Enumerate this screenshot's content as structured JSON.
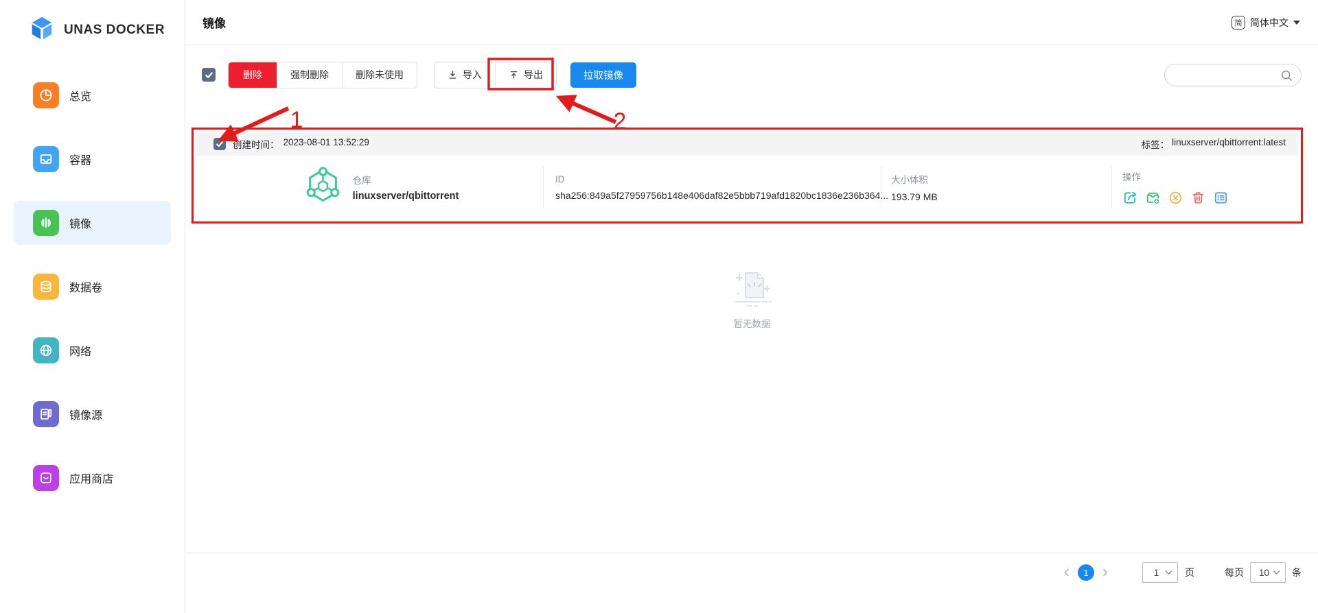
{
  "app": {
    "brand": "UNAS DOCKER"
  },
  "sidebar": {
    "items": [
      {
        "label": "总览",
        "icon": "overview-icon",
        "color": "#fa7e23",
        "active": false
      },
      {
        "label": "容器",
        "icon": "container-icon",
        "color": "#41a4f5",
        "active": false
      },
      {
        "label": "镜像",
        "icon": "image-icon",
        "color": "#47c353",
        "active": true
      },
      {
        "label": "数据卷",
        "icon": "volume-icon",
        "color": "#f6b73c",
        "active": false
      },
      {
        "label": "网络",
        "icon": "network-icon",
        "color": "#41b5c2",
        "active": false
      },
      {
        "label": "镜像源",
        "icon": "registry-icon",
        "color": "#6f6bd0",
        "active": false
      },
      {
        "label": "应用商店",
        "icon": "appstore-icon",
        "color": "#bb41e5",
        "active": false
      }
    ]
  },
  "header": {
    "title": "镜像",
    "language_badge": "简",
    "language": "简体中文"
  },
  "toolbar": {
    "delete": "删除",
    "force_delete": "强制删除",
    "delete_unused": "删除未使用",
    "import": "导入",
    "export": "导出",
    "pull_image": "拉取镜像",
    "search_value": ""
  },
  "image_card": {
    "created_label": "创建时间：",
    "created_time": "2023-08-01 13:52:29",
    "tag_label": "标签：",
    "tag_value": "linuxserver/qbittorrent:latest",
    "repo_label": "仓库",
    "repo_value": "linuxserver/qbittorrent",
    "id_label": "ID",
    "id_value": "sha256:849a5f27959756b148e406daf82e5bbb719afd1820bc1836e236b364...",
    "size_label": "大小体积",
    "size_value": "193.79 MB",
    "actions_label": "操作",
    "action_icons": [
      "export-image-icon",
      "package-add-icon",
      "cancel-circle-icon",
      "trash-icon",
      "detail-list-icon"
    ]
  },
  "empty": {
    "text": "暂无数据"
  },
  "pagination": {
    "current_page": "1",
    "page_select_value": "1",
    "page_unit": "页",
    "per_page_label": "每页",
    "per_page_value": "10",
    "per_page_unit": "条"
  },
  "annotations": {
    "step1": "1",
    "step2": "2"
  },
  "colors": {
    "accent_blue": "#1789f0",
    "danger_red": "#ee1e2e",
    "annotation_red": "#e31b1b",
    "link_blue": "#6d9bf1",
    "checkbox": "#5d6d88",
    "sidebar_active_bg": "#e9f3fd",
    "repo_icon_green": "#3ec999"
  }
}
